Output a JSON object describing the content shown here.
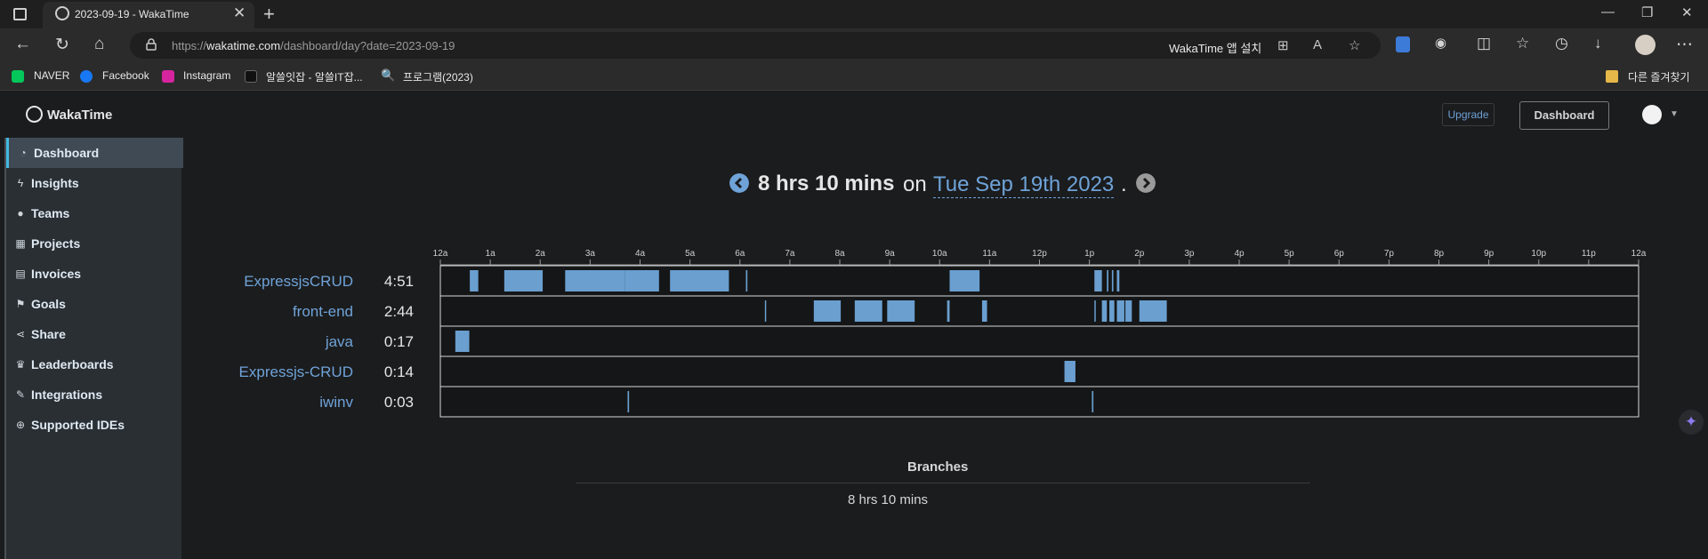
{
  "browser": {
    "tab_title": "2023-09-19 - WakaTime",
    "url_prefix": "https://",
    "url_host": "wakatime.com",
    "url_path": "/dashboard/day?date=2023-09-19",
    "install_label": "WakaTime 앱 설치",
    "bookmarks": [
      "NAVER",
      "Facebook",
      "Instagram",
      "알쓸잇잡 - 알쓸IT잡...",
      "프로그램(2023)"
    ],
    "other_bookmarks": "다른 즐겨찾기"
  },
  "header": {
    "logo": "WakaTime",
    "upgrade": "Upgrade",
    "dashboard": "Dashboard"
  },
  "sidebar": {
    "items": [
      {
        "label": "Dashboard",
        "icon": "dashboard-icon"
      },
      {
        "label": "Insights",
        "icon": "bolt-icon"
      },
      {
        "label": "Teams",
        "icon": "users-icon"
      },
      {
        "label": "Projects",
        "icon": "grid-icon"
      },
      {
        "label": "Invoices",
        "icon": "invoice-icon"
      },
      {
        "label": "Goals",
        "icon": "flag-icon"
      },
      {
        "label": "Share",
        "icon": "share-icon"
      },
      {
        "label": "Leaderboards",
        "icon": "trophy-icon"
      },
      {
        "label": "Integrations",
        "icon": "wrench-icon"
      },
      {
        "label": "Supported IDEs",
        "icon": "plus-circle-icon"
      }
    ]
  },
  "summary": {
    "total": "8 hrs 10 mins",
    "on": "on",
    "date": "Tue Sep 19th 2023",
    "dot": "."
  },
  "chart_data": {
    "type": "timeline",
    "x_ticks": [
      "12a",
      "1a",
      "2a",
      "3a",
      "4a",
      "5a",
      "6a",
      "7a",
      "8a",
      "9a",
      "10a",
      "11a",
      "12p",
      "1p",
      "2p",
      "3p",
      "4p",
      "5p",
      "6p",
      "7p",
      "8p",
      "9p",
      "10p",
      "11p",
      "12a"
    ],
    "rows": [
      {
        "name": "ExpressjsCRUD",
        "total": "4:51",
        "segments": [
          [
            0.59,
            0.76
          ],
          [
            1.28,
            2.05
          ],
          [
            2.5,
            3.7
          ],
          [
            3.7,
            4.38
          ],
          [
            4.6,
            5.78
          ],
          [
            6.12,
            6.15
          ],
          [
            10.2,
            10.8
          ],
          [
            13.1,
            13.25
          ],
          [
            13.35,
            13.38
          ],
          [
            13.45,
            13.48
          ],
          [
            13.55,
            13.6
          ]
        ]
      },
      {
        "name": "front-end",
        "total": "2:44",
        "segments": [
          [
            6.5,
            6.52
          ],
          [
            7.48,
            8.02
          ],
          [
            8.3,
            8.85
          ],
          [
            8.95,
            9.5
          ],
          [
            10.15,
            10.2
          ],
          [
            10.85,
            10.95
          ],
          [
            13.1,
            13.12
          ],
          [
            13.25,
            13.35
          ],
          [
            13.4,
            13.5
          ],
          [
            13.55,
            13.7
          ],
          [
            13.72,
            13.85
          ],
          [
            14.0,
            14.55
          ]
        ]
      },
      {
        "name": "java",
        "total": "0:17",
        "segments": [
          [
            0.3,
            0.58
          ]
        ]
      },
      {
        "name": "Expressjs-CRUD",
        "total": "0:14",
        "segments": [
          [
            12.5,
            12.72
          ]
        ]
      },
      {
        "name": "iwinv",
        "total": "0:03",
        "segments": [
          [
            3.75,
            3.78
          ],
          [
            13.05,
            13.08
          ]
        ]
      }
    ],
    "bar_color": "#6a9fd0"
  },
  "branches": {
    "title": "Branches",
    "total": "8 hrs 10 mins"
  }
}
